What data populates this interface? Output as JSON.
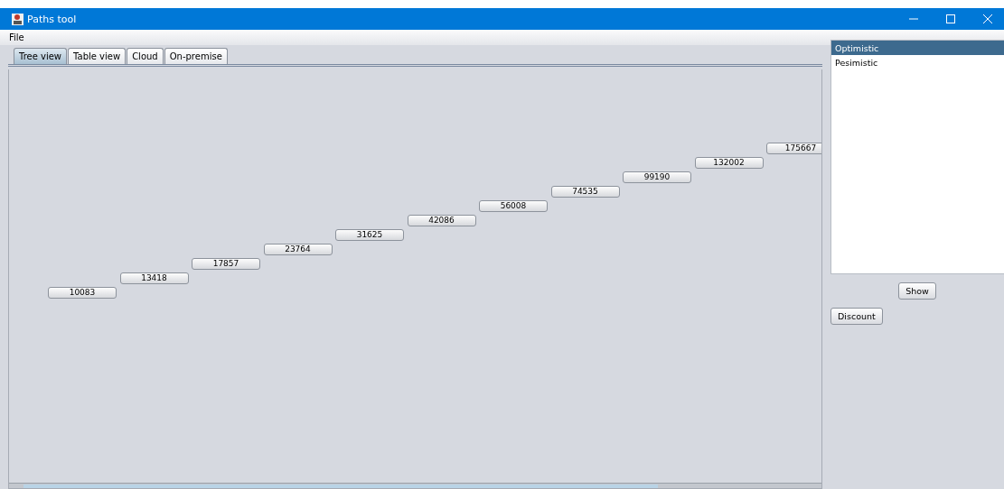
{
  "window": {
    "title": "Paths tool"
  },
  "menu": [
    "File"
  ],
  "tabs": [
    {
      "label": "Tree view",
      "selected": true
    },
    {
      "label": "Table view",
      "selected": false
    },
    {
      "label": "Cloud",
      "selected": false
    },
    {
      "label": "On-premise",
      "selected": false
    }
  ],
  "tree_nodes": [
    "10083",
    "13418",
    "17857",
    "23764",
    "31625",
    "42086",
    "56008",
    "74535",
    "99190",
    "132002",
    "175667"
  ],
  "scenarios": [
    {
      "label": "Optimistic",
      "selected": true
    },
    {
      "label": "Pesimistic",
      "selected": false
    }
  ],
  "buttons": {
    "show": "Show",
    "discount": "Discount"
  }
}
